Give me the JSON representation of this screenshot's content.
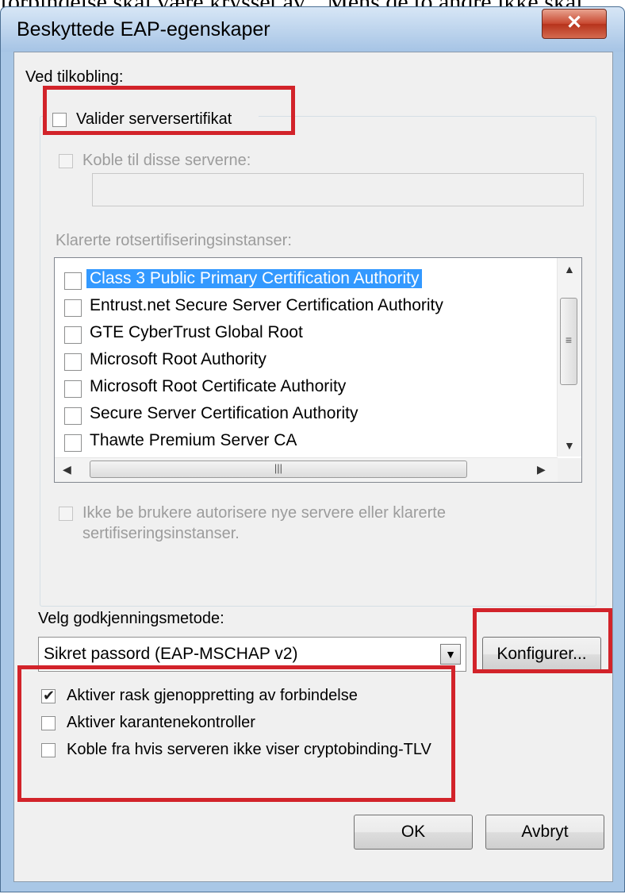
{
  "top_text": "forbindelse skal være krysset av\". Mens de to andre ikke skal",
  "window": {
    "title": "Beskyttede EAP-egenskaper",
    "close_glyph": "✕"
  },
  "connection": {
    "heading": "Ved tilkobling:",
    "validate_server_cert": {
      "label": "Valider serversertifikat",
      "checked": false
    },
    "connect_to_servers": {
      "label": "Koble til disse serverne:",
      "checked": false,
      "value": ""
    },
    "trusted_roots_label": "Klarerte rotsertifiseringsinstanser:",
    "trusted_roots": [
      {
        "label": "Class 3 Public Primary Certification Authority",
        "checked": false,
        "selected": true
      },
      {
        "label": "Entrust.net Secure Server Certification Authority",
        "checked": false
      },
      {
        "label": "GTE CyberTrust Global Root",
        "checked": false
      },
      {
        "label": "Microsoft Root Authority",
        "checked": false
      },
      {
        "label": "Microsoft Root Certificate Authority",
        "checked": false
      },
      {
        "label": "Secure Server Certification Authority",
        "checked": false
      },
      {
        "label": "Thawte Premium Server CA",
        "checked": false
      }
    ],
    "no_prompt": {
      "label_line1": "Ikke be brukere autorisere nye servere eller klarerte",
      "label_line2": "sertifiseringsinstanser.",
      "checked": false
    }
  },
  "auth_method": {
    "label": "Velg godkjenningsmetode:",
    "selected": "Sikret passord (EAP-MSCHAP v2)",
    "configure_button": "Konfigurer..."
  },
  "options": [
    {
      "label": "Aktiver rask gjenoppretting av forbindelse",
      "checked": true
    },
    {
      "label": "Aktiver karantenekontroller",
      "checked": false
    },
    {
      "label": "Koble fra hvis serveren ikke viser cryptobinding-TLV",
      "checked": false
    }
  ],
  "buttons": {
    "ok": "OK",
    "cancel": "Avbryt"
  },
  "glyphs": {
    "check": "✔",
    "up": "▲",
    "down": "▼",
    "left": "◀",
    "right": "▶",
    "grip_v": "≡",
    "grip_h": "|||"
  },
  "colors": {
    "highlight_box": "#d2232a",
    "selection": "#3399ff"
  }
}
